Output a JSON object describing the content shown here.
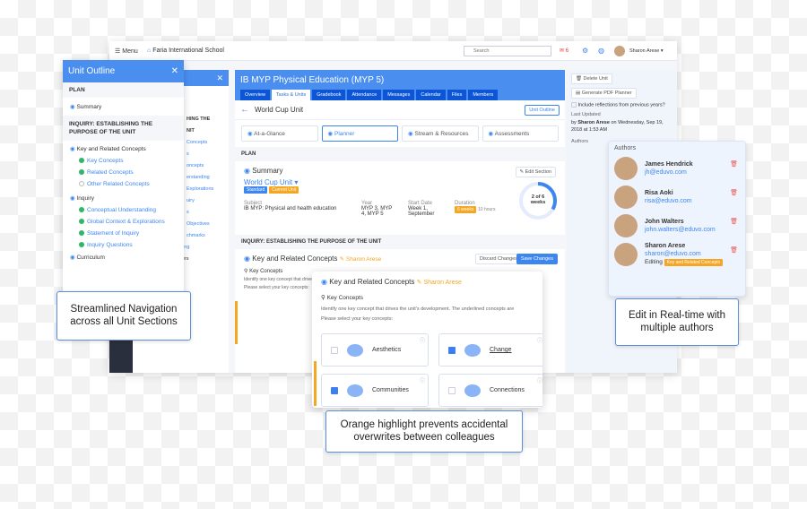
{
  "header": {
    "menu": "Menu",
    "school": "Faria International School",
    "search_placeholder": "Search",
    "mail_count": "6",
    "user": "Sharon Arese"
  },
  "course": {
    "title": "IB MYP Physical Education (MYP 5)",
    "tabs": [
      "Overview",
      "Tasks & Units",
      "Gradebook",
      "Attendance",
      "Messages",
      "Calendar",
      "Files",
      "Members"
    ],
    "active_tab": "Tasks & Units"
  },
  "unit": {
    "title": "World Cup Unit",
    "outline_button": "Unit Outline",
    "subtabs": [
      "At-a-Glance",
      "Planner",
      "Stream & Resources",
      "Assessments"
    ],
    "active_subtab": "Planner"
  },
  "plan": {
    "section": "PLAN",
    "summary_title": "Summary",
    "edit_button": "Edit Section",
    "unit_name": "World Cup Unit",
    "badges": [
      "Standard",
      "Current Unit"
    ],
    "subject_label": "Subject",
    "subject": "IB MYP: Physical and health education",
    "year_label": "Year",
    "year": "MYP 3, MYP 4, MYP 5",
    "start_label": "Start Date",
    "start": "Week 1, September",
    "duration_label": "Duration",
    "duration": "6 weeks",
    "hours": "10 hours",
    "progress_text": "2 of 6 weeks",
    "progress": 0.333
  },
  "inquiry": {
    "section": "INQUIRY: ESTABLISHING THE PURPOSE OF THE UNIT",
    "title": "Key and Related Concepts",
    "editor": "Sharon Arese",
    "discard": "Discard Changes",
    "save": "Save Changes",
    "key_concepts": "Key Concepts",
    "identify": "Identify one key concept that drives the unit's development. The underlined concepts are",
    "please": "Please select your key concepts:",
    "concepts": [
      {
        "name": "Aesthetics",
        "checked": false
      },
      {
        "name": "Change",
        "checked": true
      },
      {
        "name": "Communities",
        "checked": true
      },
      {
        "name": "Connections",
        "checked": false
      }
    ]
  },
  "outline": {
    "title": "Unit Outline",
    "plan": "PLAN",
    "summary": "Summary",
    "inquiry": "INQUIRY: ESTABLISHING THE PURPOSE OF THE UNIT",
    "krc": "Key and Related Concepts",
    "krc_items": [
      "Key Concepts",
      "Related Concepts",
      "Other Related Concepts"
    ],
    "inq": "Inquiry",
    "inq_items": [
      "Conceptual Understanding",
      "Global Context & Explorations",
      "Statement of Inquiry",
      "Inquiry Questions"
    ],
    "curriculum": "Curriculum",
    "bg_items": [
      "HING THE",
      "NIT",
      "Concepts",
      "s",
      "oncepts",
      "erstanding",
      "Explorations",
      "uiry",
      "s",
      "Objectives",
      "chmarks",
      "Approaches to Learning",
      "Developing IB Learners",
      "IB Learner Profile"
    ]
  },
  "right": {
    "delete": "Delete Unit",
    "pdf": "Generate PDF Planner",
    "reflections": "Include reflections from previous years?",
    "last_updated": "Last Updated",
    "updated_by": "Sharon Arese",
    "updated_on": "on Wednesday, Sep 19, 2018 at 1:53 AM",
    "by": "by",
    "authors_label": "Authors"
  },
  "authors": [
    {
      "name": "James Hendrick",
      "email": "jh@eduvo.com"
    },
    {
      "name": "Risa Aoki",
      "email": "risa@eduvo.com"
    },
    {
      "name": "John Walters",
      "email": "john.walters@eduvo.com"
    },
    {
      "name": "Sharon Arese",
      "email": "sharon@eduvo.com",
      "status": "Editing",
      "section": "Key and Related Concepts"
    }
  ],
  "callouts": {
    "nav": "Streamlined Navigation across all Unit Sections",
    "realtime": "Edit in Real-time with multiple authors",
    "orange": "Orange highlight prevents accidental overwrites between colleagues"
  },
  "colors": {
    "accent": "#4a8ff0",
    "orange": "#f5a623",
    "success": "#2fb766"
  }
}
